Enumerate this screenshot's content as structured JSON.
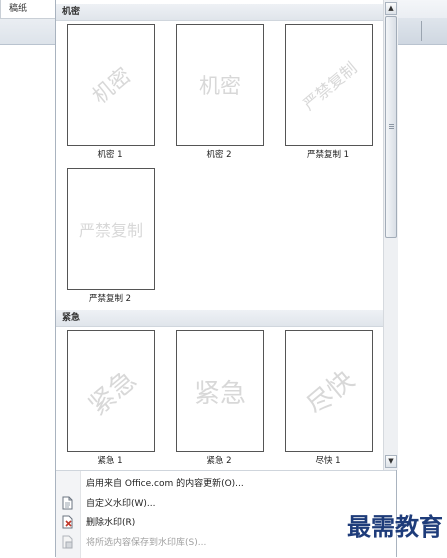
{
  "ribbon": {
    "left_tab_label": "稿纸"
  },
  "gallery": {
    "sections": [
      {
        "header": "机密",
        "items": [
          {
            "label": "机密 1",
            "watermark": "机密"
          },
          {
            "label": "机密 2",
            "watermark": "机密"
          },
          {
            "label": "严禁复制 1",
            "watermark": "严禁复制"
          },
          {
            "label": "严禁复制 2",
            "watermark": "严禁复制"
          }
        ]
      },
      {
        "header": "紧急",
        "items": [
          {
            "label": "紧急 1",
            "watermark": "紧急"
          },
          {
            "label": "紧急 2",
            "watermark": "紧急"
          },
          {
            "label": "尽快 1",
            "watermark": "尽快"
          }
        ]
      }
    ]
  },
  "scrollbar": {
    "up_icon": "scroll-up-arrow",
    "down_icon": "scroll-down-arrow"
  },
  "menu": {
    "items": [
      {
        "label": "启用来自 Office.com 的内容更新(O)...",
        "icon": "none",
        "enabled": true
      },
      {
        "label": "自定义水印(W)...",
        "icon": "page-icon",
        "enabled": true
      },
      {
        "label": "删除水印(R)",
        "icon": "delete-page-icon",
        "enabled": true
      },
      {
        "label": "将所选内容保存到水印库(S)...",
        "icon": "save-page-icon",
        "enabled": false
      }
    ]
  },
  "logo_text": "最需教育",
  "colors": {
    "accent_logo": "#1e3c7a",
    "watermark": "#d8d8d8",
    "header_bg": "#e6eaef"
  }
}
